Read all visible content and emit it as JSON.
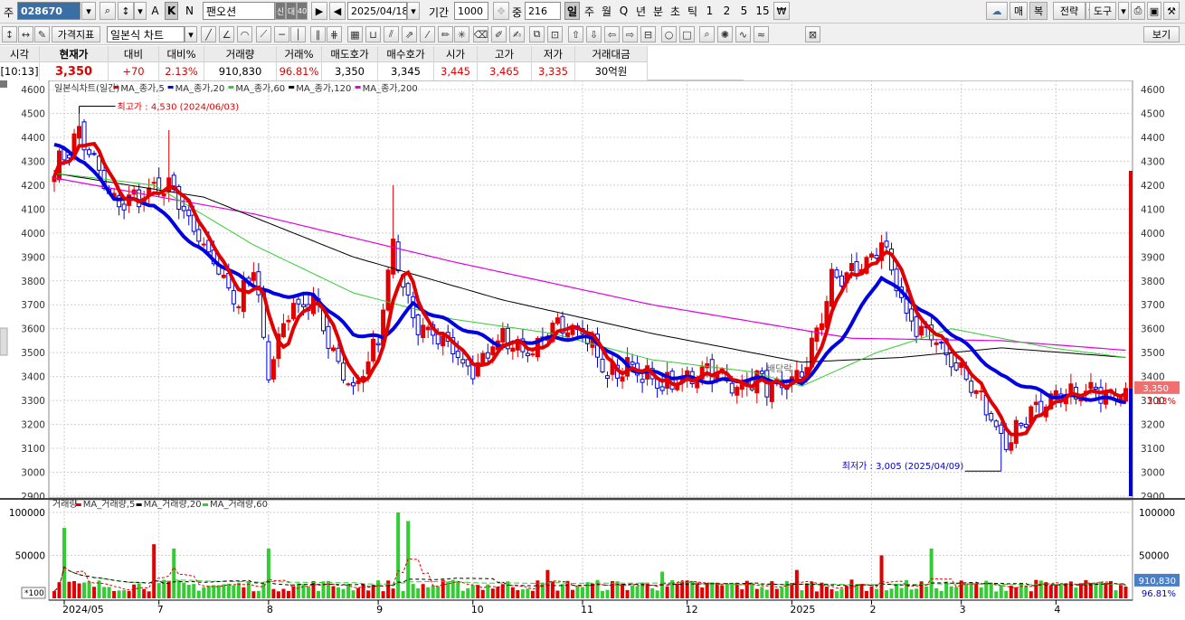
{
  "toolbar1": {
    "market_label": "주",
    "code": "028670",
    "stock_name": "팬오션",
    "badge1": "신",
    "badge2": "대",
    "badge3": "40",
    "date": "2025/04/18",
    "period_label": "기간",
    "period_value": "1000",
    "count_label": "중",
    "count_value": "216",
    "periods": [
      "일",
      "주",
      "월",
      "Q",
      "년",
      "분",
      "초",
      "틱",
      "1",
      "2",
      "5",
      "15"
    ],
    "selected_period": "일",
    "mode_k": "K",
    "mode_n": "N",
    "mode_a": "A",
    "right_buttons": [
      "매",
      "복",
      "전략",
      "도구"
    ]
  },
  "toolbar2": {
    "tab_indicator": "가격지표",
    "chart_type": "일본식 차트",
    "view_btn": "보기"
  },
  "quote": {
    "headers": [
      "시각",
      "현재가",
      "대비",
      "대비%",
      "거래량",
      "거래%",
      "매도호가",
      "매수호가",
      "시가",
      "고가",
      "저가",
      "거래대금"
    ],
    "values": [
      "[10:13]",
      "3,350",
      "+70",
      "2.13%",
      "910,830",
      "96.81%",
      "3,350",
      "3,345",
      "3,445",
      "3,465",
      "3,335",
      "30억원"
    ]
  },
  "price_panel": {
    "legend": [
      {
        "text": "일본식차트(일간)",
        "color": "#333333"
      },
      {
        "text": "MA_종가,5",
        "color": "#e00000"
      },
      {
        "text": "MA_종가,20",
        "color": "#0000e0"
      },
      {
        "text": "MA_종가,60",
        "color": "#33cc33"
      },
      {
        "text": "MA_종가,120",
        "color": "#000000"
      },
      {
        "text": "MA_종가,200",
        "color": "#e000e0"
      }
    ],
    "y_ticks": [
      "4600",
      "4500",
      "4400",
      "4300",
      "4200",
      "4100",
      "4000",
      "3900",
      "3800",
      "3700",
      "3600",
      "3500",
      "3400",
      "3300",
      "3200",
      "3100",
      "3000",
      "2900"
    ],
    "max_annotation": "최고가 : 4,530 (2024/06/03)",
    "min_annotation": "최저가 : 3,005 (2025/04/09)",
    "dividend_label": "배당락",
    "current_price_tag": "3,350",
    "change_pct_tag": "2.13%"
  },
  "volume_panel": {
    "legend": [
      {
        "text": "거래량",
        "color": "#333333"
      },
      {
        "text": "MA_거래량,5",
        "color": "#e00000"
      },
      {
        "text": "MA_거래량,20",
        "color": "#000000"
      },
      {
        "text": "MA_거래량,60",
        "color": "#33cc33"
      }
    ],
    "y_ticks": [
      "100000",
      "50000"
    ],
    "unit_label": "*100",
    "current_volume_tag": "910,830",
    "volume_pct_tag": "96.81%"
  },
  "x_axis": {
    "labels": [
      "2024/05",
      "7",
      "8",
      "9",
      "10",
      "11",
      "12",
      "2025",
      "2",
      "3",
      "4"
    ]
  },
  "chart_data": {
    "type": "candlestick",
    "x_labels": [
      "2024/05",
      "7",
      "8",
      "9",
      "10",
      "11",
      "12",
      "2025",
      "2",
      "3",
      "4"
    ],
    "y_range": [
      2900,
      4600
    ],
    "volume_range": [
      0,
      100000
    ],
    "volume_unit": "*100",
    "highest": {
      "value": 4530,
      "date": "2024/06/03"
    },
    "lowest": {
      "value": 3005,
      "date": "2025/04/09"
    },
    "last_close": 3350,
    "close_anchors": [
      [
        0,
        4260
      ],
      [
        5,
        4420
      ],
      [
        12,
        4120
      ],
      [
        17,
        4150
      ],
      [
        23,
        4200
      ],
      [
        28,
        4000
      ],
      [
        33,
        3850
      ],
      [
        37,
        3700
      ],
      [
        40,
        3850
      ],
      [
        43,
        3420
      ],
      [
        47,
        3680
      ],
      [
        52,
        3720
      ],
      [
        56,
        3500
      ],
      [
        60,
        3340
      ],
      [
        65,
        3550
      ],
      [
        68,
        3950
      ],
      [
        72,
        3620
      ],
      [
        78,
        3560
      ],
      [
        83,
        3420
      ],
      [
        90,
        3570
      ],
      [
        96,
        3480
      ],
      [
        101,
        3630
      ],
      [
        106,
        3600
      ],
      [
        111,
        3400
      ],
      [
        116,
        3450
      ],
      [
        121,
        3360
      ],
      [
        126,
        3380
      ],
      [
        131,
        3440
      ],
      [
        136,
        3360
      ],
      [
        141,
        3390
      ],
      [
        146,
        3330
      ],
      [
        151,
        3450
      ],
      [
        156,
        3800
      ],
      [
        161,
        3840
      ],
      [
        166,
        3950
      ],
      [
        171,
        3650
      ],
      [
        176,
        3560
      ],
      [
        181,
        3450
      ],
      [
        186,
        3300
      ],
      [
        191,
        3120
      ],
      [
        196,
        3260
      ],
      [
        201,
        3300
      ],
      [
        206,
        3330
      ],
      [
        215,
        3350
      ]
    ],
    "ma20_anchors": [
      [
        0,
        4370
      ],
      [
        6,
        4300
      ],
      [
        12,
        4150
      ],
      [
        20,
        4120
      ],
      [
        28,
        3950
      ],
      [
        36,
        3830
      ],
      [
        44,
        3740
      ],
      [
        52,
        3740
      ],
      [
        60,
        3580
      ],
      [
        66,
        3560
      ],
      [
        72,
        3700
      ],
      [
        80,
        3620
      ],
      [
        90,
        3530
      ],
      [
        100,
        3560
      ],
      [
        108,
        3560
      ],
      [
        116,
        3430
      ],
      [
        124,
        3400
      ],
      [
        132,
        3380
      ],
      [
        142,
        3390
      ],
      [
        150,
        3370
      ],
      [
        158,
        3560
      ],
      [
        166,
        3820
      ],
      [
        174,
        3680
      ],
      [
        182,
        3550
      ],
      [
        190,
        3400
      ],
      [
        200,
        3320
      ],
      [
        215,
        3300
      ]
    ],
    "ma60_anchors": [
      [
        0,
        4250
      ],
      [
        20,
        4200
      ],
      [
        40,
        3950
      ],
      [
        60,
        3750
      ],
      [
        80,
        3640
      ],
      [
        100,
        3580
      ],
      [
        120,
        3470
      ],
      [
        140,
        3420
      ],
      [
        150,
        3360
      ],
      [
        165,
        3500
      ],
      [
        180,
        3600
      ],
      [
        200,
        3520
      ],
      [
        215,
        3480
      ]
    ],
    "ma120_anchors": [
      [
        0,
        4250
      ],
      [
        30,
        4150
      ],
      [
        60,
        3900
      ],
      [
        90,
        3720
      ],
      [
        120,
        3580
      ],
      [
        150,
        3460
      ],
      [
        170,
        3480
      ],
      [
        190,
        3520
      ],
      [
        215,
        3480
      ]
    ],
    "ma200_anchors": [
      [
        0,
        4230
      ],
      [
        40,
        4080
      ],
      [
        80,
        3880
      ],
      [
        120,
        3700
      ],
      [
        160,
        3560
      ],
      [
        190,
        3550
      ],
      [
        215,
        3510
      ]
    ],
    "volume_spikes": {
      "2": 82000,
      "20": 63000,
      "24": 58000,
      "43": 58000,
      "69": 100000,
      "71": 90000,
      "99": 33000,
      "122": 31000,
      "149": 33000,
      "166": 50000,
      "176": 58000
    }
  },
  "colors": {
    "up": "#e00000",
    "down": "#0000d0",
    "ma5": "#e00000",
    "ma20": "#0000e0",
    "ma60": "#33cc33",
    "ma120": "#000000",
    "ma200": "#e000e0",
    "grid": "#cfcfcf"
  }
}
